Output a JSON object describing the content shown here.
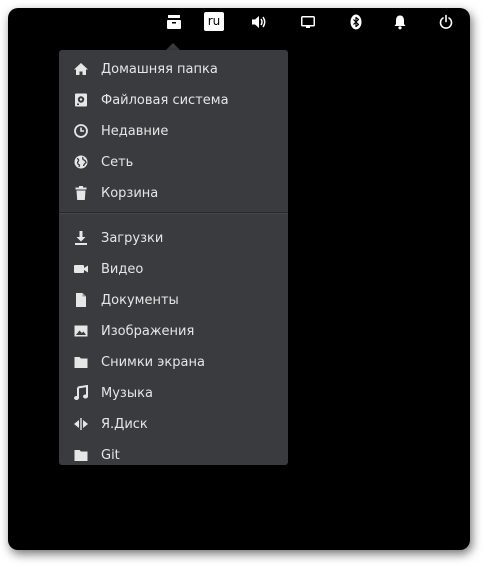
{
  "topbar": {
    "keyboard_layout": "ru",
    "icons": [
      "files-icon",
      "volume-icon",
      "display-icon",
      "bluetooth-icon",
      "notifications-icon",
      "power-icon"
    ]
  },
  "places_menu": {
    "system_items": [
      {
        "label": "Домашняя папка",
        "icon": "home-icon"
      },
      {
        "label": "Файловая система",
        "icon": "drive-icon"
      },
      {
        "label": "Недавние",
        "icon": "clock-icon"
      },
      {
        "label": "Сеть",
        "icon": "globe-icon"
      },
      {
        "label": "Корзина",
        "icon": "trash-icon"
      }
    ],
    "bookmark_items": [
      {
        "label": "Загрузки",
        "icon": "download-icon"
      },
      {
        "label": "Видео",
        "icon": "video-icon"
      },
      {
        "label": "Документы",
        "icon": "document-icon"
      },
      {
        "label": "Изображения",
        "icon": "image-icon"
      },
      {
        "label": "Снимки экрана",
        "icon": "folder-icon"
      },
      {
        "label": "Музыка",
        "icon": "music-icon"
      },
      {
        "label": "Я.Диск",
        "icon": "yadisk-icon"
      },
      {
        "label": "Git",
        "icon": "folder-icon"
      }
    ]
  },
  "colors": {
    "screen_bg": "#000000",
    "menu_bg": "#393b3f",
    "menu_text": "#e6e6e6",
    "icon_color": "#e6e6e6"
  }
}
